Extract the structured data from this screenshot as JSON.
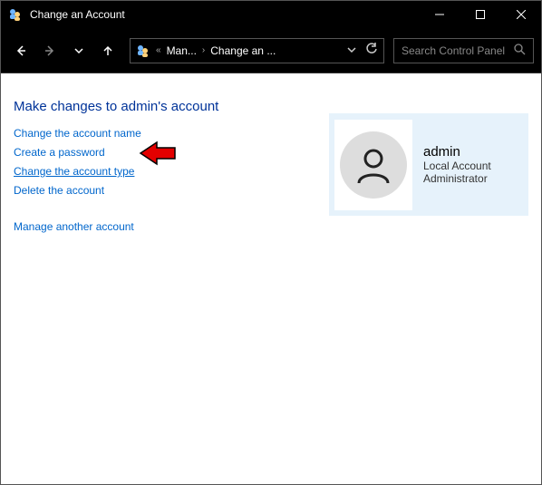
{
  "titlebar": {
    "title": "Change an Account"
  },
  "breadcrumb": {
    "prefix": "«",
    "crumb1": "Man...",
    "crumb2": "Change an ..."
  },
  "search": {
    "placeholder": "Search Control Panel"
  },
  "page": {
    "heading": "Make changes to admin's account",
    "links": {
      "change_name": "Change the account name",
      "create_password": "Create a password",
      "change_type": "Change the account type",
      "delete_account": "Delete the account",
      "manage_another": "Manage another account"
    }
  },
  "account": {
    "name": "admin",
    "line1": "Local Account",
    "line2": "Administrator"
  }
}
